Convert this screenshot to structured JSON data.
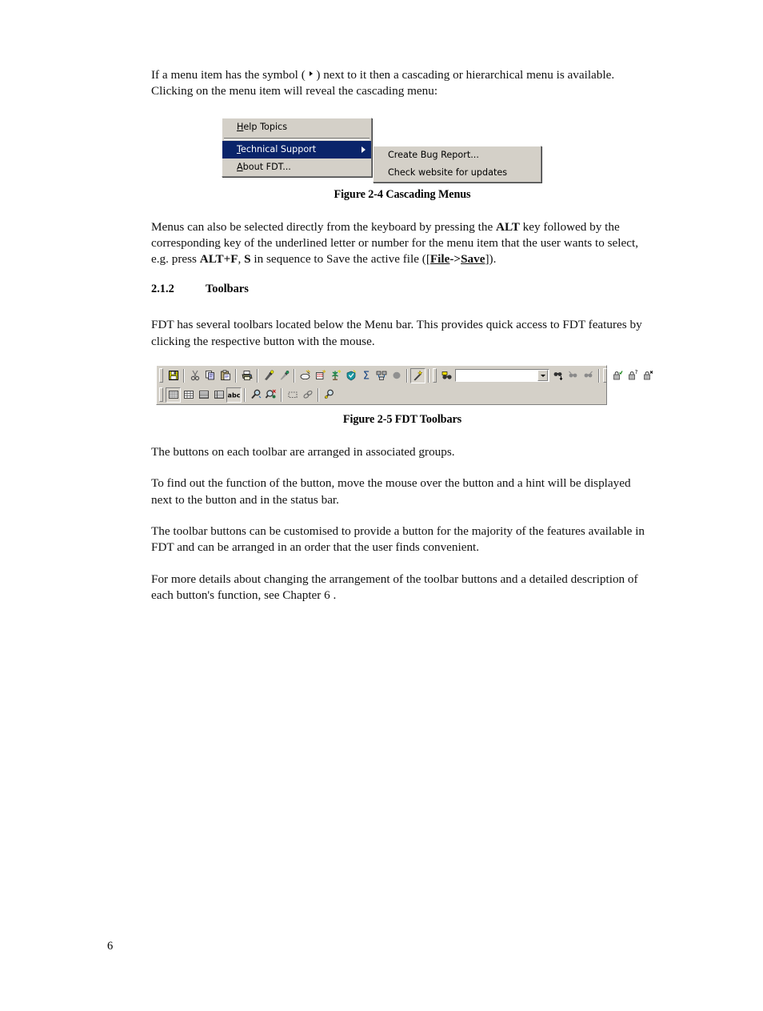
{
  "document": {
    "page_number": "6",
    "intro_paragraph": {
      "before_symbol": "If a menu item has the symbol ( ",
      "after_symbol": " ) next to it then a cascading or hierarchical menu is available. Clicking on the menu item will reveal the cascading menu:"
    },
    "figure_2_4": {
      "caption": "Figure 2-4 Cascading Menus",
      "menu": {
        "items": [
          {
            "accel": "H",
            "rest": "elp Topics",
            "selected": false,
            "has_submenu": false
          },
          {
            "accel": "T",
            "rest": "echnical Support",
            "selected": true,
            "has_submenu": true,
            "full_label": "Technical Support"
          },
          {
            "accel": "A",
            "rest": "bout FDT...",
            "selected": false,
            "has_submenu": false
          }
        ]
      },
      "submenu": {
        "items": [
          {
            "label": "Create Bug Report..."
          },
          {
            "label": "Check website for updates"
          }
        ]
      }
    },
    "keyboard_paragraph": {
      "part1": "Menus can also be selected directly from the keyboard by pressing the ",
      "alt": "ALT",
      "part2": " key followed by the corresponding key of the underlined letter or number for the menu item that the user wants to select, e.g. press ",
      "altf": "ALT+F",
      "part3": ", ",
      "s_key": "S",
      "part4": " in sequence to Save the active file ([",
      "file": "File",
      "arrow": "->",
      "save": "Save",
      "part5": "])."
    },
    "section": {
      "number": "2.1.2",
      "title": "Toolbars"
    },
    "toolbars_intro": "FDT has several toolbars located below the Menu bar. This provides quick access to FDT features by clicking the respective button with the mouse.",
    "figure_2_5": {
      "caption": "Figure 2-5 FDT Toolbars",
      "combo_value": "",
      "row1_icons": [
        "save-icon",
        "cut-icon",
        "copy-icon",
        "paste-icon",
        "print-icon",
        "pick-tool-icon",
        "eyedropper-icon",
        "eraser-icon",
        "grid-points-icon",
        "vegetation-icon",
        "shield-icon",
        "sigma-icon",
        "network-icon",
        "ellipse-icon",
        "magic-wand-icon",
        "find-icon",
        "find-next-icon",
        "find-prev-icon",
        "find-all-icon",
        "lock-check-icon",
        "lock-question-icon",
        "lock-x-icon"
      ],
      "row2_icons": [
        "grid-dense-icon",
        "grid-medium-icon",
        "grid-rows-icon",
        "grid-table-icon",
        "abc-icon",
        "zoom-select-icon",
        "zoom-region-icon",
        "marquee-icon",
        "link-icon",
        "zoom-tool-icon"
      ],
      "abc_label": "abc"
    },
    "paragraph_groups": "The buttons on each toolbar are arranged in associated groups.",
    "paragraph_hint": "To find out the function of the button, move the mouse over the button and a hint will be displayed next to the button and in the status bar.",
    "paragraph_customise": "The toolbar buttons can be customised to provide a button for the majority of the features available in FDT and can be arranged in an order that the user finds convenient.",
    "paragraph_chapter": "For more details about changing the arrangement of the toolbar buttons and a detailed description of each button's function, see Chapter 6 ."
  }
}
